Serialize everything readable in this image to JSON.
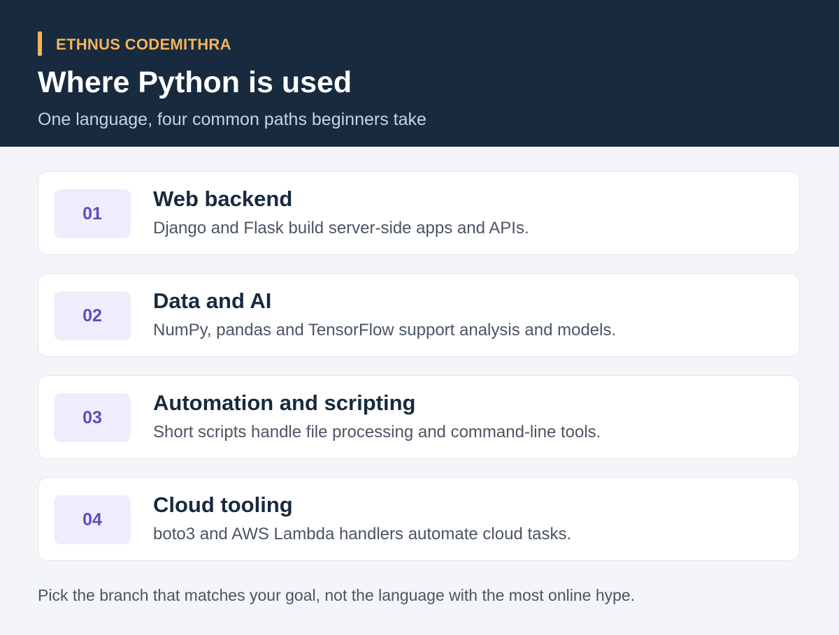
{
  "header": {
    "brand": "ETHNUS CODEMITHRA",
    "title": "Where Python is used",
    "subtitle": "One language, four common paths beginners take"
  },
  "items": [
    {
      "number": "01",
      "title": "Web backend",
      "description": "Django and Flask build server-side apps and APIs."
    },
    {
      "number": "02",
      "title": "Data and AI",
      "description": "NumPy, pandas and TensorFlow support analysis and models."
    },
    {
      "number": "03",
      "title": "Automation and scripting",
      "description": "Short scripts handle file processing and command-line tools."
    },
    {
      "number": "04",
      "title": "Cloud tooling",
      "description": "boto3 and AWS Lambda handlers automate cloud tasks."
    }
  ],
  "footer": "Pick the branch that matches your goal, not the language with the most online hype.",
  "colors": {
    "header_background": "#172a3e",
    "accent": "#f6b25a",
    "number_text": "#5a4fb8",
    "number_background": "#efedfc"
  }
}
